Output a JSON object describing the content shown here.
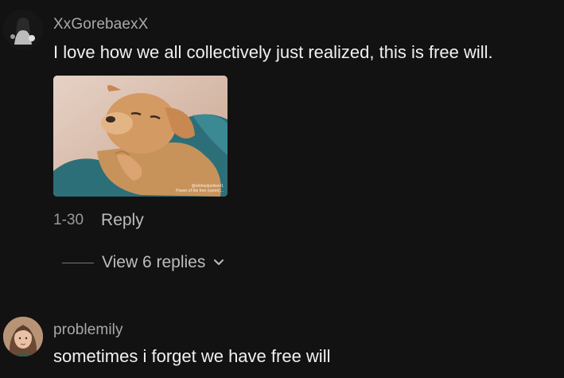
{
  "comments": [
    {
      "username": "XxGorebaexX",
      "text": "I love how we all collectively just realized, this is free will.",
      "gif": {
        "watermark_line1": "@ohtheplpeline41",
        "watermark_line2": "Power of the free (ramm)..."
      },
      "timestamp": "1-30",
      "reply_label": "Reply",
      "view_replies_label": "View 6 replies"
    },
    {
      "username": "problemily",
      "text": "sometimes i forget we have free will"
    }
  ],
  "colors": {
    "background": "#121212",
    "username": "#a9a9a9",
    "text": "#f1f1f1",
    "secondary": "#bdbdbd"
  },
  "icons": {
    "chevron": "chevron-down-icon"
  }
}
